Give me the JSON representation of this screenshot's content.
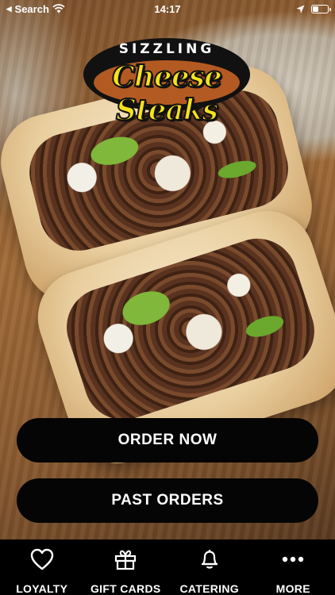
{
  "status_bar": {
    "back_label": "Search",
    "time": "14:17"
  },
  "logo": {
    "line1": "SIZZLING",
    "line2": "Cheese Steaks"
  },
  "actions": {
    "order_now": "ORDER NOW",
    "past_orders": "PAST ORDERS"
  },
  "tabs": [
    {
      "label": "LOYALTY",
      "icon": "heart-icon"
    },
    {
      "label": "GIFT CARDS",
      "icon": "gift-icon"
    },
    {
      "label": "CATERING",
      "icon": "bell-icon"
    },
    {
      "label": "MORE",
      "icon": "more-dots-icon"
    }
  ],
  "colors": {
    "button_bg": "#050505",
    "tabbar_bg": "#000000",
    "logo_yellow": "#f5e21a",
    "logo_brown": "#b35a22"
  }
}
